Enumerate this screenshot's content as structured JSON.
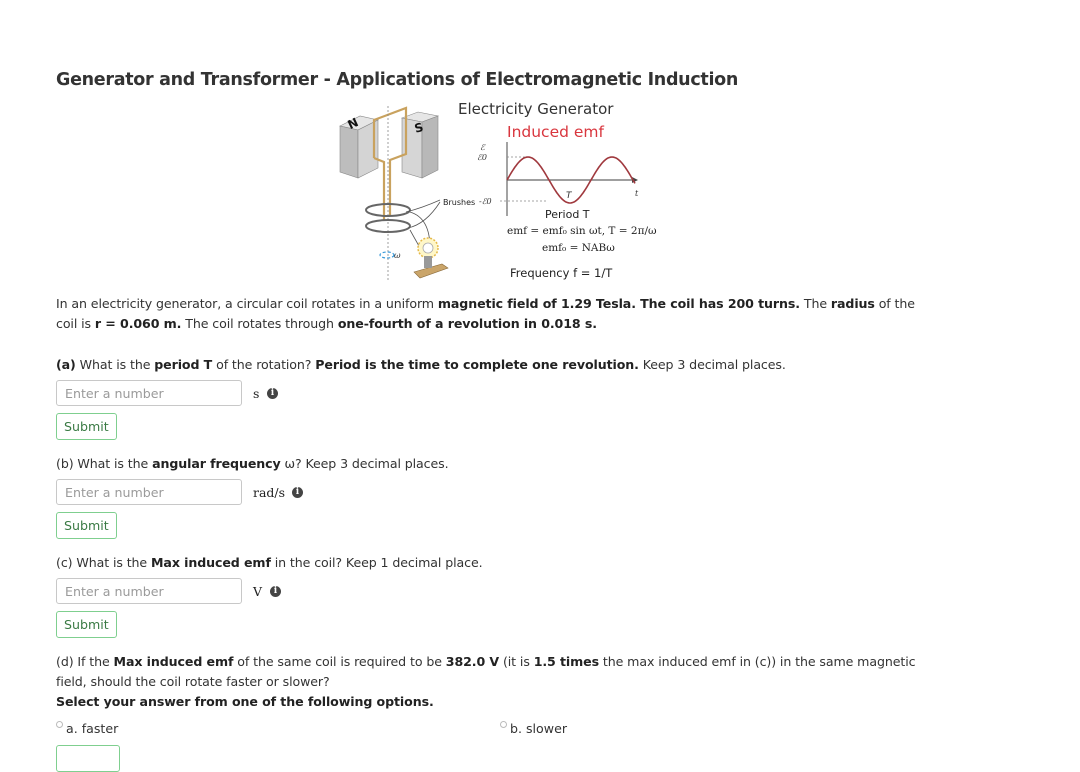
{
  "page": {
    "title": "Generator and Transformer - Applications of Electromagnetic Induction"
  },
  "figure": {
    "title": "Electricity Generator",
    "emf_title": "Induced emf",
    "axis_y_label": "ℰ",
    "axis_y_max": "ℰ0",
    "axis_y_min": "-ℰ0",
    "axis_x_label": "t",
    "period_mark": "T",
    "brushes_label": "Brushes",
    "magnet_n": "N",
    "magnet_s": "S",
    "omega_label": "ω",
    "period_caption": "Period T",
    "formula_emf": "emf = emf₀ sin ωt,  T = 2π/ω",
    "formula_emf0": "emf₀ = NABω",
    "frequency_caption": "Frequency f = 1/T",
    "colors": {
      "emf_title": "#d9363e",
      "wave": "#a0393e",
      "coil": "#c9a25e"
    }
  },
  "problem": {
    "intro_line1_parts": [
      {
        "t": "In an electricity generator,  a circular coil rotates in a uniform ",
        "b": false
      },
      {
        "t": "magnetic field of 1.29 Tesla.  The coil has 200 turns.",
        "b": true
      },
      {
        "t": " The ",
        "b": false
      },
      {
        "t": "radius",
        "b": true
      },
      {
        "t": " of the",
        "b": false
      }
    ],
    "intro_line2_parts": [
      {
        "t": "coil is ",
        "b": false
      },
      {
        "t": "r = 0.060 m.",
        "b": true
      },
      {
        "t": " The coil rotates through ",
        "b": false
      },
      {
        "t": "one-fourth of a revolution in 0.018 s.",
        "b": true
      }
    ],
    "magnetic_field_T": 1.29,
    "turns": 200,
    "radius_m": 0.06,
    "quarter_rev_time_s": 0.018
  },
  "questions": {
    "a": {
      "text_parts": [
        {
          "t": "(a)",
          "b": true
        },
        {
          "t": " What is the ",
          "b": false
        },
        {
          "t": "period T",
          "b": true
        },
        {
          "t": " of the rotation? ",
          "b": false
        },
        {
          "t": "Period is the time to complete one revolution.",
          "b": true
        },
        {
          "t": " Keep 3 decimal places.",
          "b": false
        }
      ],
      "placeholder": "Enter a number",
      "value": "",
      "unit": "s",
      "submit": "Submit"
    },
    "b": {
      "text_parts": [
        {
          "t": "(b) What is the ",
          "b": false
        },
        {
          "t": "angular frequency",
          "b": true
        },
        {
          "t": " ω? Keep 3 decimal places.",
          "b": false
        }
      ],
      "placeholder": "Enter a number",
      "value": "",
      "unit": "rad/s",
      "submit": "Submit"
    },
    "c": {
      "text_parts": [
        {
          "t": "(c) What is the ",
          "b": false
        },
        {
          "t": "Max induced emf",
          "b": true
        },
        {
          "t": " in the coil?  Keep 1 decimal place.",
          "b": false
        }
      ],
      "placeholder": "Enter a number",
      "value": "",
      "unit": "V",
      "submit": "Submit"
    },
    "d": {
      "line1_parts": [
        {
          "t": "(d) If the ",
          "b": false
        },
        {
          "t": "Max induced emf",
          "b": true
        },
        {
          "t": " of the same coil is required to be ",
          "b": false
        },
        {
          "t": "382.0 V",
          "b": true
        },
        {
          "t": " (it is ",
          "b": false
        },
        {
          "t": "1.5 times",
          "b": true
        },
        {
          "t": " the max induced emf in (c)) in the same magnetic",
          "b": false
        }
      ],
      "line2": "field, should the coil rotate faster or slower?",
      "instruction": "Select your answer from one of the following options.",
      "options": [
        {
          "label": "a. faster",
          "selected": false
        },
        {
          "label": "b. slower",
          "selected": false
        }
      ]
    }
  }
}
